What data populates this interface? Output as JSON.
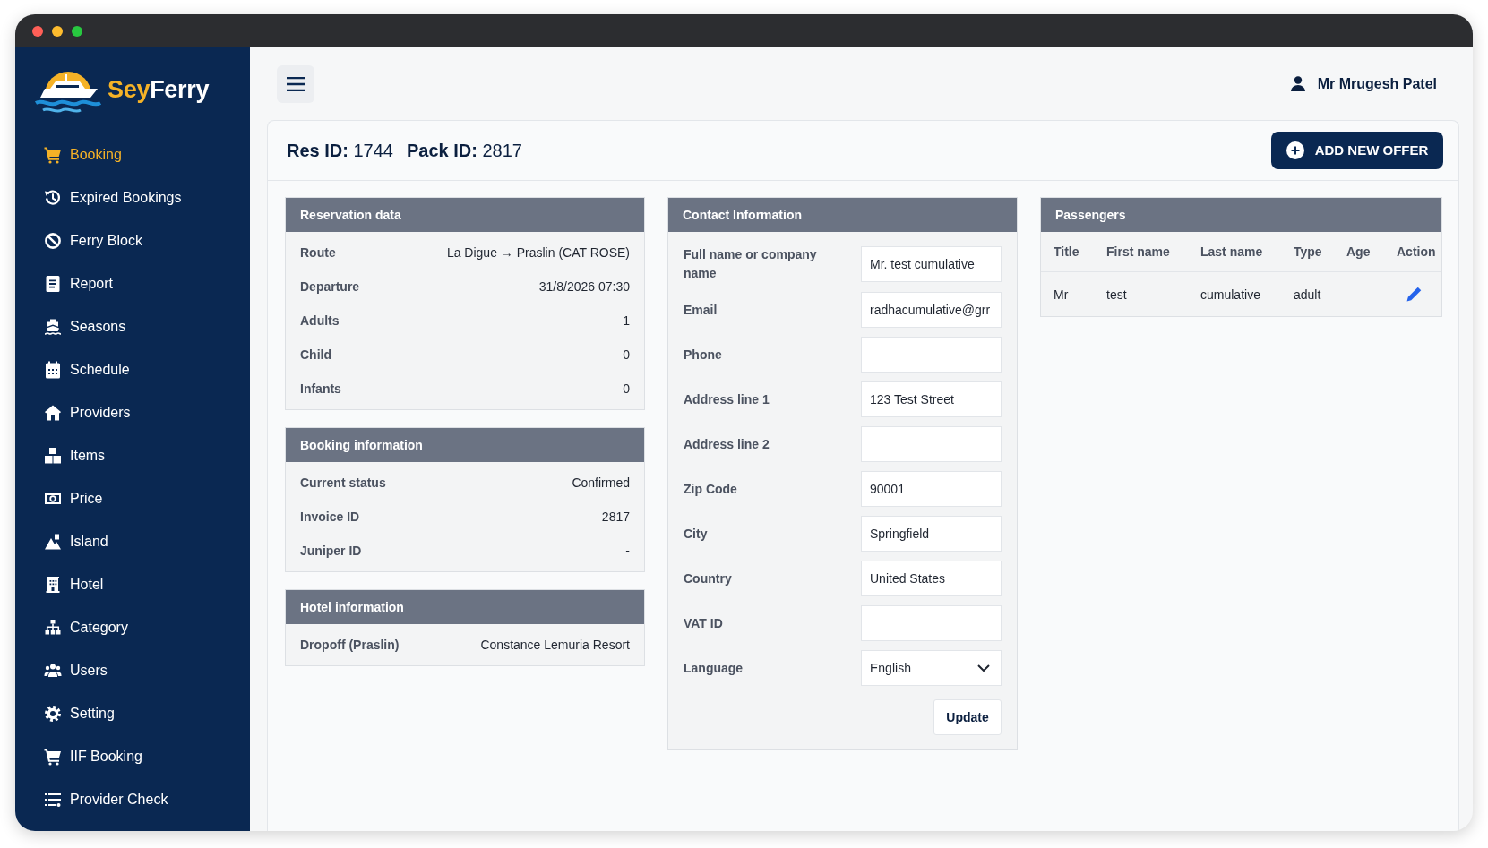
{
  "sidebar": {
    "logo": {
      "accent": "Sey",
      "name": "Ferry"
    },
    "items": [
      {
        "label": "Booking",
        "selected": true
      },
      {
        "label": "Expired Bookings",
        "selected": false
      },
      {
        "label": "Ferry Block",
        "selected": false
      },
      {
        "label": "Report",
        "selected": false
      },
      {
        "label": "Seasons",
        "selected": false
      },
      {
        "label": "Schedule",
        "selected": false
      },
      {
        "label": "Providers",
        "selected": false
      },
      {
        "label": "Items",
        "selected": false
      },
      {
        "label": "Price",
        "selected": false
      },
      {
        "label": "Island",
        "selected": false
      },
      {
        "label": "Hotel",
        "selected": false
      },
      {
        "label": "Category",
        "selected": false
      },
      {
        "label": "Users",
        "selected": false
      },
      {
        "label": "Setting",
        "selected": false
      },
      {
        "label": "IIF Booking",
        "selected": false
      },
      {
        "label": "Provider Check",
        "selected": false
      }
    ]
  },
  "header": {
    "user_name": "Mr Mrugesh Patel"
  },
  "booking": {
    "res_id": "**Res ID:** 1744",
    "pack_id": "**Pack ID:** 2817",
    "add_offer_button": "ADD NEW OFFER",
    "reservation_data": {
      "title": "Reservation data",
      "rows": [
        {
          "label": "Route",
          "value": "La Digue → Praslin (CAT ROSE)"
        },
        {
          "label": "Departure",
          "value": "31/8/2026 07:30"
        },
        {
          "label": "Adults",
          "value": "1"
        },
        {
          "label": "Child",
          "value": "0"
        },
        {
          "label": "Infants",
          "value": "0"
        }
      ]
    },
    "booking_information": {
      "title": "Booking information",
      "rows": [
        {
          "label": "Current status",
          "value": "Confirmed"
        },
        {
          "label": "Invoice ID",
          "value": "2817"
        },
        {
          "label": "Juniper ID",
          "value": "-"
        }
      ]
    },
    "hotel_information": {
      "title": "Hotel information",
      "rows": [
        {
          "label": "Dropoff (Praslin)",
          "value": "Constance Lemuria Resort"
        }
      ]
    },
    "contact_information": {
      "title": "Contact Information",
      "fields": [
        {
          "label": "Full name or company name",
          "value": "Mr. test cumulative",
          "kind": "text"
        },
        {
          "label": "Email",
          "value": "radhacumulative@grr",
          "kind": "text"
        },
        {
          "label": "Phone",
          "kind": "text"
        },
        {
          "label": "Address line 1",
          "value": "123 Test Street",
          "kind": "text"
        },
        {
          "label": "Address line 2",
          "kind": "text"
        },
        {
          "label": "Zip Code",
          "value": "90001",
          "kind": "text"
        },
        {
          "label": "City",
          "value": "Springfield",
          "kind": "text"
        },
        {
          "label": "Country",
          "value": "United States",
          "kind": "text"
        },
        {
          "label": "VAT ID",
          "kind": "text"
        },
        {
          "label": "Language",
          "value": "English",
          "kind": "select"
        }
      ],
      "update_button": "Update"
    },
    "passengers": {
      "title": "Passengers",
      "columns": [
        "Title",
        "First name",
        "Last name",
        "Type",
        "Age",
        "Action"
      ],
      "rows": [
        {
          "title": "Mr",
          "first_name": "test",
          "last_name": "cumulative",
          "type": "adult"
        }
      ]
    }
  }
}
